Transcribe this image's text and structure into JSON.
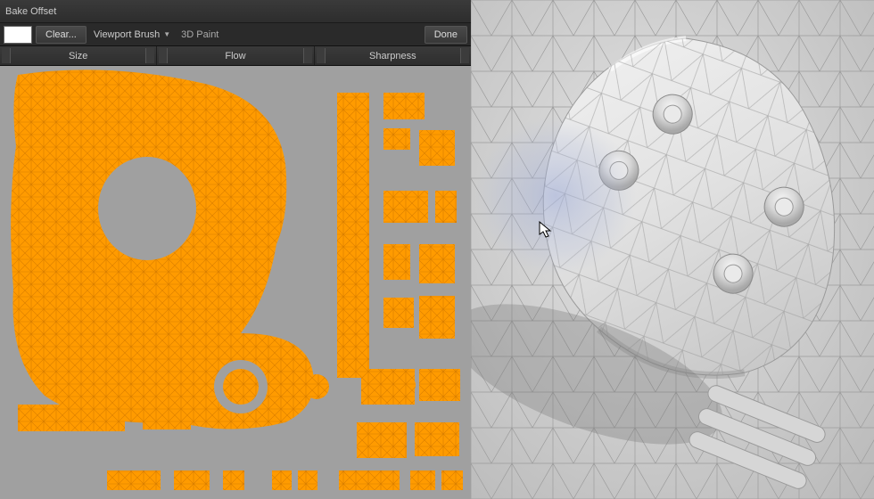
{
  "panel": {
    "title": "Bake Offset",
    "color_swatch": "#ffffff",
    "clear_button": "Clear...",
    "brush_dropdown": "Viewport Brush",
    "view_mode": "3D Paint",
    "done_button": "Done",
    "sliders": {
      "size": "Size",
      "flow": "Flow",
      "sharpness": "Sharpness"
    }
  },
  "colors": {
    "uv_bg": "#a0a0a0",
    "uv_fill": "#ff9b00",
    "viewport_bg": "#cacaca",
    "wire": "#9e9e9e"
  }
}
